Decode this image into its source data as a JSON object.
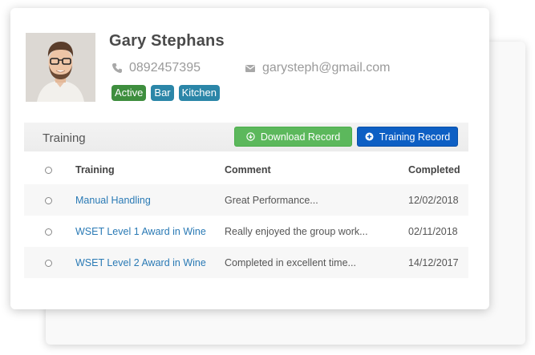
{
  "profile": {
    "name": "Gary Stephans",
    "phone": "0892457395",
    "email": "garysteph@gmail.com",
    "tags": [
      {
        "label": "Active",
        "color": "#3e8e3e"
      },
      {
        "label": "Bar",
        "color": "#2b86a8"
      },
      {
        "label": "Kitchen",
        "color": "#2b86a8"
      }
    ]
  },
  "section": {
    "title": "Training",
    "download_button": "Download Record",
    "training_button": "Training Record"
  },
  "table": {
    "headers": {
      "training": "Training",
      "comment": "Comment",
      "completed": "Completed"
    },
    "rows": [
      {
        "training": "Manual Handling",
        "comment": "Great Performance...",
        "completed": "12/02/2018"
      },
      {
        "training": "WSET Level 1 Award in Wine",
        "comment": "Really enjoyed the group work...",
        "completed": "02/11/2018"
      },
      {
        "training": "WSET Level 2 Award in Wine",
        "comment": "Completed in excellent time...",
        "completed": "14/12/2017"
      }
    ]
  },
  "colors": {
    "download_button": "#5cb85c",
    "training_button": "#0d5fc4",
    "link": "#2a7ab5"
  }
}
